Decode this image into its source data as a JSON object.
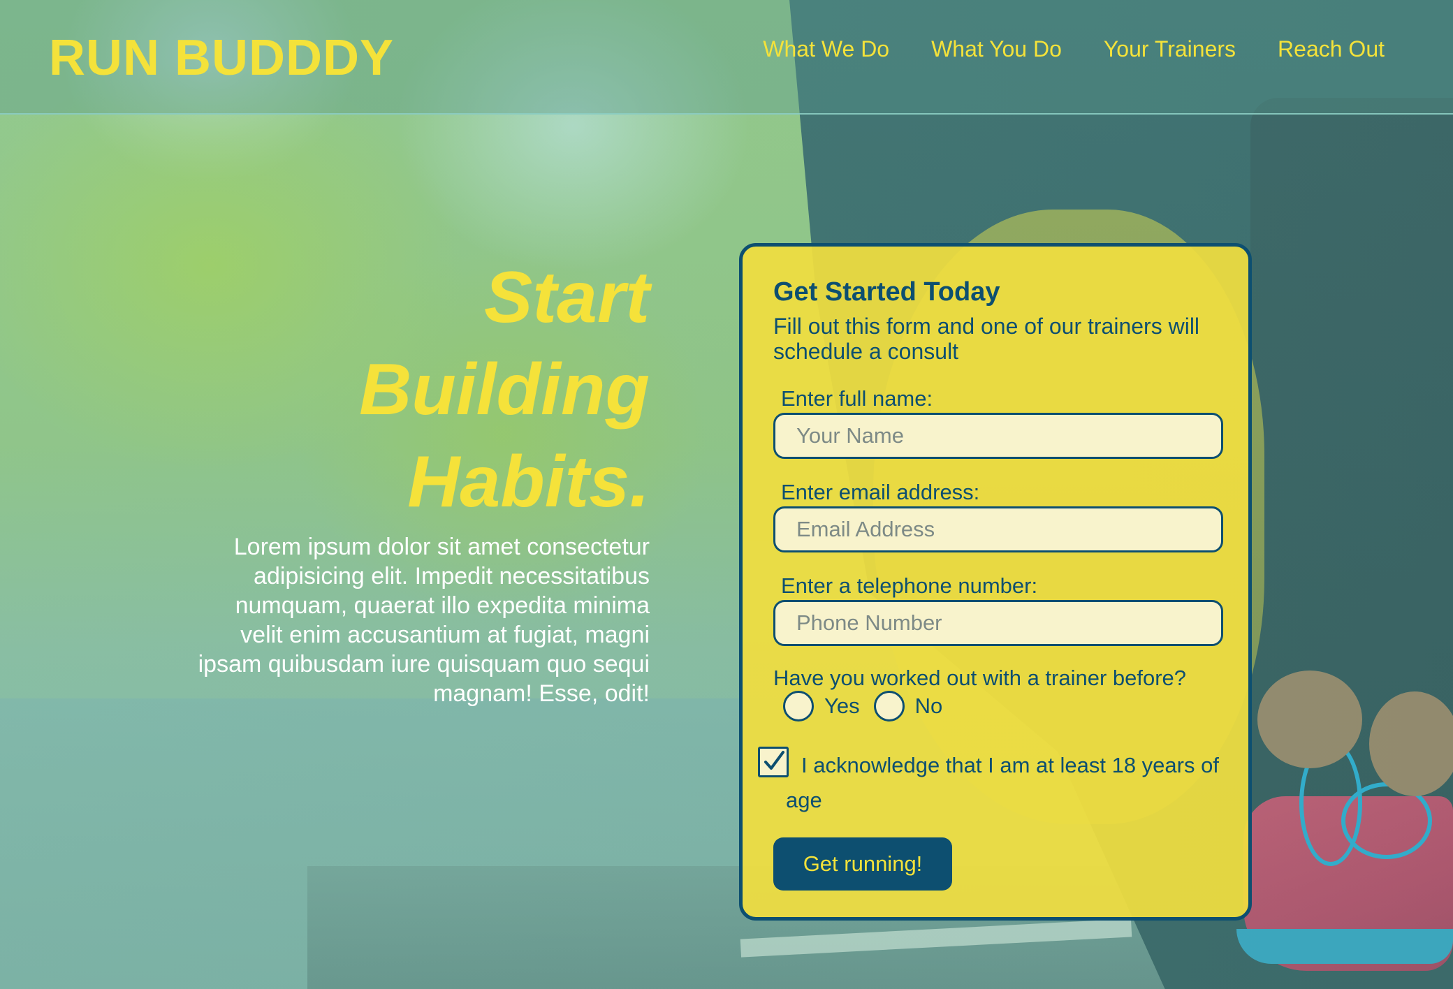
{
  "brand": "RUN BUDDDY",
  "nav": [
    "What We Do",
    "What You Do",
    "Your Trainers",
    "Reach Out"
  ],
  "hero": {
    "title_lines": [
      "Start",
      "Building",
      "Habits."
    ],
    "text": "Lorem ipsum dolor sit amet consectetur adipisicing elit. Impedit necessitatibus numquam, quaerat illo expedita minima velit enim accusantium at fugiat, magni ipsam quibusdam iure quisquam quo sequi magnam! Esse, odit!"
  },
  "form": {
    "title": "Get Started Today",
    "subtitle": "Fill out this form and one of our trainers will schedule a consult",
    "name_label": "Enter full name:",
    "name_placeholder": "Your Name",
    "email_label": "Enter email address:",
    "email_placeholder": "Email Address",
    "phone_label": "Enter a telephone number:",
    "phone_placeholder": "Phone Number",
    "question": "Have you worked out with a trainer before?",
    "options": [
      "Yes",
      "No"
    ],
    "acknowledge": "I acknowledge that I am at least 18 years of age",
    "acknowledge_checked": true,
    "submit": "Get running!"
  },
  "colors": {
    "accent_yellow": "#f4e23a",
    "navy": "#0d4f70",
    "field_bg": "#f8f3cc"
  }
}
